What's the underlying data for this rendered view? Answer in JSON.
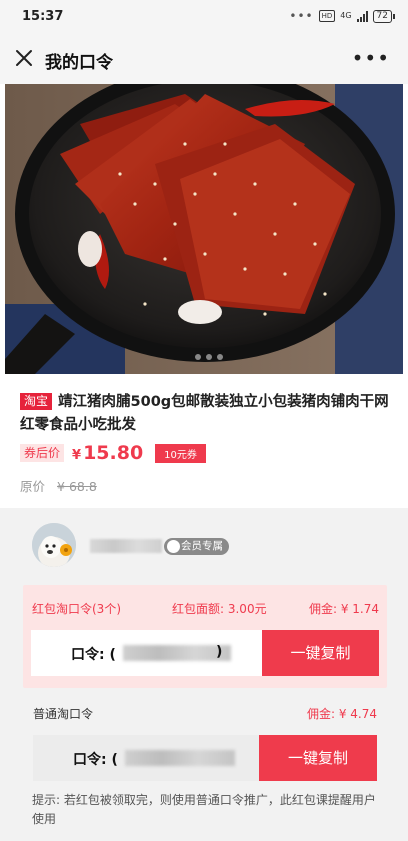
{
  "status_bar": {
    "time": "15:37",
    "dots": "•••",
    "hd": "HD",
    "network": "4G",
    "battery": "72"
  },
  "header": {
    "title": "我的口令",
    "more": "•••"
  },
  "product": {
    "platform_tag": "淘宝",
    "title": "靖江猪肉脯500g包邮散装独立小包装猪肉铺肉干网红零食品小吃批发",
    "after_coupon_label": "券后价",
    "currency": "¥",
    "price": "15.80",
    "coupon": "10元券",
    "original_label": "原价",
    "original_price": "¥ 68.8"
  },
  "member_badge": "会员专属",
  "red_envelope": {
    "name": "红包淘口令(3个)",
    "amount": "红包面额: 3.00元",
    "commission": "佣金: ¥ 1.74",
    "code_label": "口令: (",
    "code_close": ")",
    "copy_label": "一键复制"
  },
  "normal": {
    "name": "普通淘口令",
    "commission": "佣金: ¥ 4.74",
    "code_label": "口令: (",
    "copy_label": "一键复制"
  },
  "tip": "提示: 若红包被领取完，则使用普通口令推广，此红包课提醒用户使用"
}
